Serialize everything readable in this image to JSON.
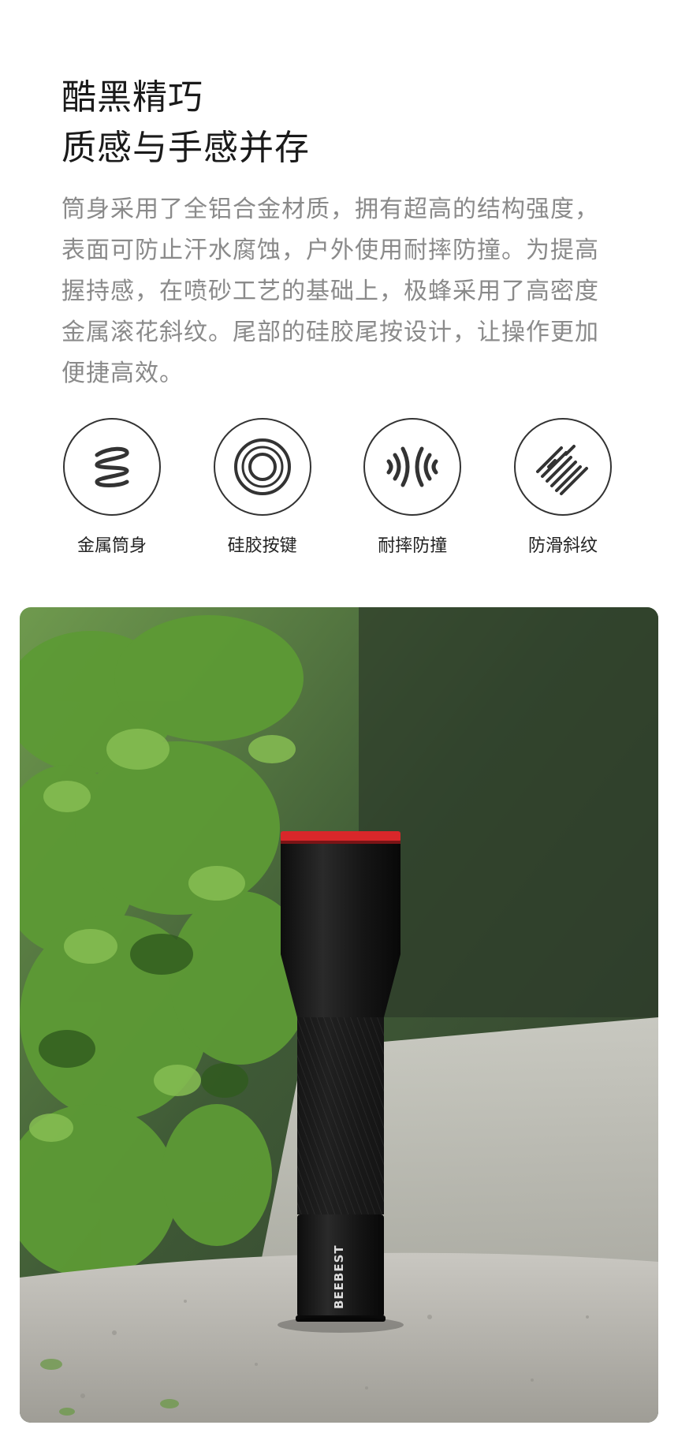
{
  "heading": {
    "line1": "酷黑精巧",
    "line2": "质感与手感并存"
  },
  "description": "筒身采用了全铝合金材质，拥有超高的结构强度，表面可防止汗水腐蚀，户外使用耐摔防撞。为提高握持感，在喷砂工艺的基础上，极蜂采用了高密度金属滚花斜纹。尾部的硅胶尾按设计，让操作更加便捷高效。",
  "features": [
    {
      "label": "金属筒身",
      "icon": "spring-coil-icon"
    },
    {
      "label": "硅胶按键",
      "icon": "concentric-rings-icon"
    },
    {
      "label": "耐摔防撞",
      "icon": "shock-waves-icon"
    },
    {
      "label": "防滑斜纹",
      "icon": "diagonal-knurl-icon"
    }
  ],
  "product_photo": {
    "brand_text": "BEEBEST",
    "colors": {
      "cap": "#d9272a",
      "body": "#141414",
      "foliage": "#4f8a2e",
      "stone": "#b8b6b0"
    }
  }
}
